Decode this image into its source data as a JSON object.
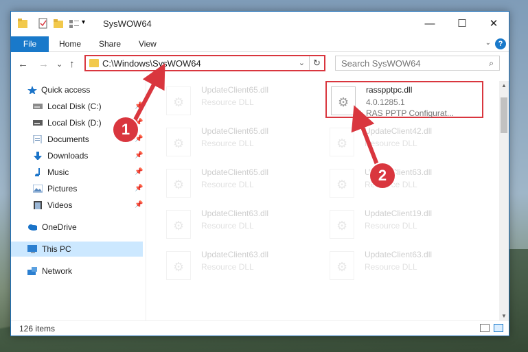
{
  "window": {
    "title": "SysWOW64",
    "quick_access_chevron": "▾",
    "controls": {
      "minimize": "—",
      "maximize": "☐",
      "close": "✕"
    }
  },
  "ribbon": {
    "tabs": [
      "File",
      "Home",
      "Share",
      "View"
    ],
    "collapse": "⌄",
    "help": "?"
  },
  "nav": {
    "back": "←",
    "forward": "→",
    "recent": "⌄",
    "up": "↑",
    "address": "C:\\Windows\\SysWOW64",
    "address_dropdown": "⌄",
    "refresh": "↻",
    "search_placeholder": "Search SysWOW64",
    "search_glyph": "⌕"
  },
  "sidebar": {
    "items": [
      {
        "label": "Quick access",
        "icon": "star-icon",
        "color": "#1a73c8"
      },
      {
        "label": "Local Disk (C:)",
        "icon": "drive-icon",
        "pinned": true
      },
      {
        "label": "Local Disk (D:)",
        "icon": "drive-icon",
        "pinned": true
      },
      {
        "label": "Documents",
        "icon": "documents-icon",
        "pinned": true
      },
      {
        "label": "Downloads",
        "icon": "download-icon",
        "pinned": true
      },
      {
        "label": "Music",
        "icon": "music-icon",
        "pinned": true
      },
      {
        "label": "Pictures",
        "icon": "pictures-icon",
        "pinned": true
      },
      {
        "label": "Videos",
        "icon": "videos-icon",
        "pinned": true
      },
      {
        "label": "OneDrive",
        "icon": "onedrive-icon"
      },
      {
        "label": "This PC",
        "icon": "computer-icon",
        "selected": true
      },
      {
        "label": "Network",
        "icon": "network-icon"
      }
    ],
    "pin_glyph": "📌"
  },
  "files": {
    "left": [
      {
        "name": "UpdateClient65.dll",
        "type": "Resource DLL"
      },
      {
        "name": "UpdateClient65.dll",
        "type": "Resource DLL"
      },
      {
        "name": "UpdateClient65.dll",
        "type": "Resource DLL"
      },
      {
        "name": "UpdateClient63.dll",
        "type": "Resource DLL"
      },
      {
        "name": "UpdateClient63.dll",
        "type": "Resource DLL"
      }
    ],
    "right": [
      {
        "name": "rasspptpc.dll",
        "version": "4.0.1285.1",
        "type": "RAS PPTP Configurat...",
        "highlighted": true
      },
      {
        "name": "UpdateClient42.dll",
        "type": "Resource DLL"
      },
      {
        "name": "UpdateClient63.dll",
        "type": "Resource DLL"
      },
      {
        "name": "UpdateClient19.dll",
        "type": "Resource DLL"
      },
      {
        "name": "UpdateClient63.dll",
        "type": "Resource DLL"
      }
    ],
    "file_glyph": "⚙"
  },
  "status": {
    "item_count": "126 items"
  },
  "annotations": {
    "callout_1": "1",
    "callout_2": "2",
    "color": "#d9363e"
  }
}
